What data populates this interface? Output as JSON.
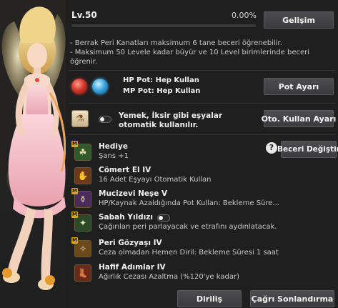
{
  "level": {
    "label": "Lv.50",
    "percent_text": "0.00%",
    "progress_fraction": 0.0
  },
  "buttons": {
    "growth": "Gelişim",
    "pot_settings": "Pot Ayarı",
    "auto_use_settings": "Oto. Kullan Ayarı",
    "change_skill": "Beceri Değiştir",
    "revive": "Diriliş",
    "end_summon": "Çağrı Sonlandırma"
  },
  "info_lines": [
    "- Berrak Peri Kanatları maksimum 6 tane beceri öğrenebilir.",
    "- Maksimum 50 Levele kadar büyür ve 10 Level birimlerinde beceri öğrenir."
  ],
  "potions": {
    "hp": "HP Pot: Hep Kullan",
    "mp": "MP Pot: Hep Kullan"
  },
  "auto_use": {
    "text": "Yemek, İksir gibi eşyalar otomatik kullanılır.",
    "enabled": false
  },
  "skills": [
    {
      "name": "Hediye",
      "desc": "Şans +1",
      "icon": "clover-icon",
      "master": true,
      "icon_color": "#2f5a2a"
    },
    {
      "name": "Cömert El IV",
      "desc": "16 Adet Eşyayı Otomatik Kullan",
      "icon": "hand-icon",
      "master": false,
      "icon_color": "#6a3a1a"
    },
    {
      "name": "Mucizevi Neşe V",
      "desc": "HP/Kaynak Azaldığında Pot Kullan: Bekleme Süre...",
      "icon": "potion-icon",
      "master": true,
      "icon_color": "#4a2a5a"
    },
    {
      "name": "Sabah Yıldızı",
      "desc": "Çağırılan peri parlayacak ve etrafını aydınlatacak.",
      "icon": "lantern-icon",
      "master": true,
      "icon_color": "#2a4a2a",
      "toggle": false
    },
    {
      "name": "Peri Gözyaşı IV",
      "desc": "Ceza olmadan Hemen Diril: Bekleme Süresi 1 saat",
      "icon": "angel-icon",
      "master": true,
      "icon_color": "#6a4a1a"
    },
    {
      "name": "Hafif Adımlar IV",
      "desc": "Ağırlık Cezası Azaltma (%120'ye kadar)",
      "icon": "boot-icon",
      "master": false,
      "icon_color": "#6a2a1a"
    }
  ],
  "colors": {
    "accent_gold": "#d9a22e",
    "panel_bg": "#1f1f20",
    "button_bg": "#444446"
  }
}
